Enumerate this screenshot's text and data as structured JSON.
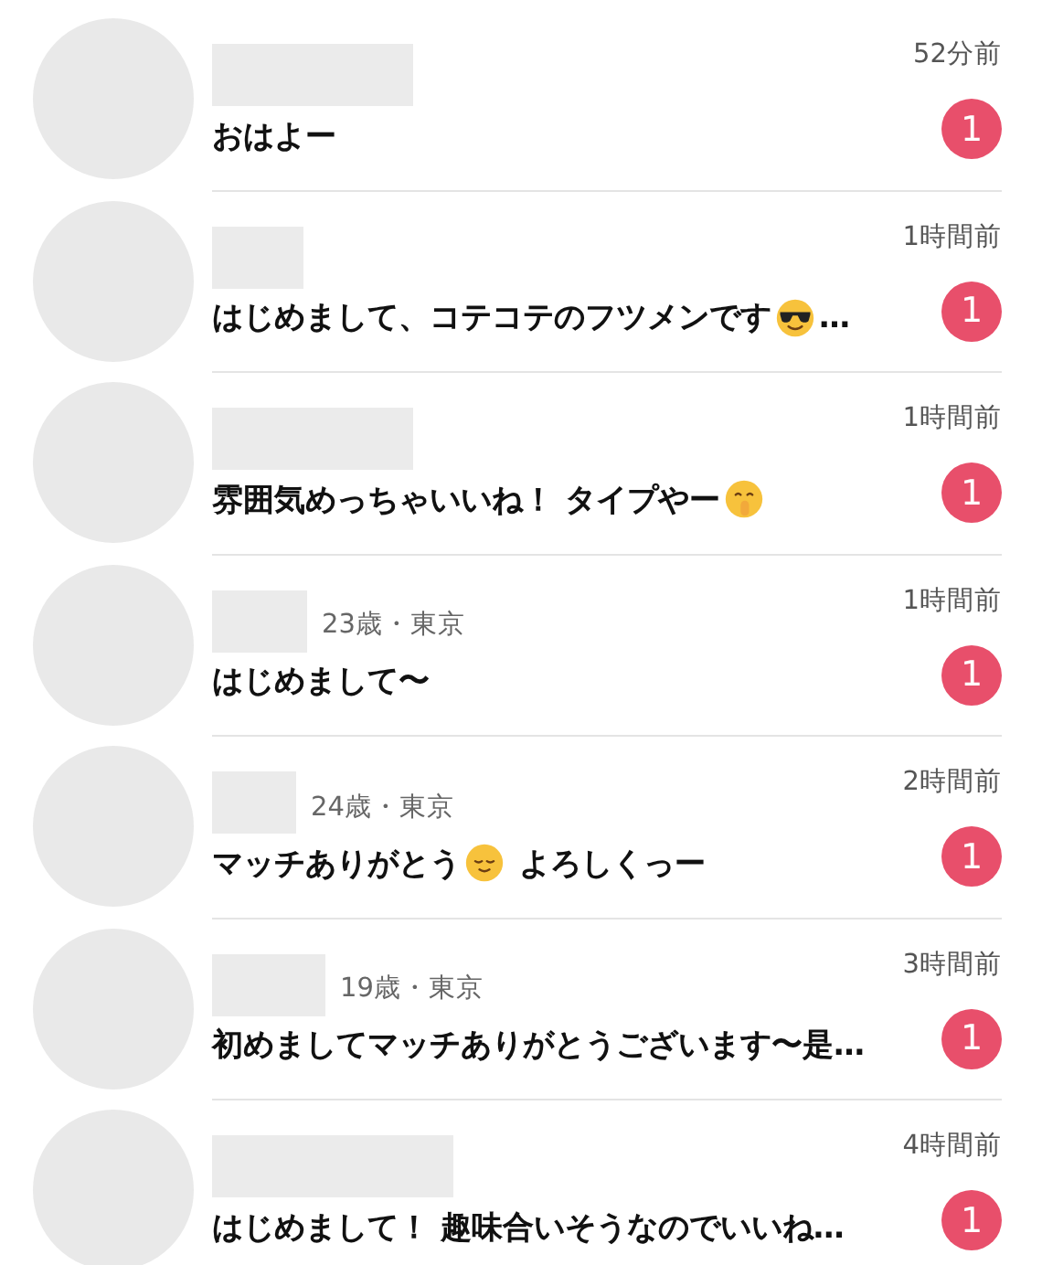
{
  "chats": [
    {
      "time": "52分前",
      "message": [
        {
          "kind": "text",
          "text": "おはよー"
        }
      ],
      "unread": "1"
    },
    {
      "time": "1時間前",
      "message": [
        {
          "kind": "text",
          "text": "はじめまして、コテコテのフツメンです"
        },
        {
          "kind": "cool-emoji"
        },
        {
          "kind": "text",
          "text": "…"
        }
      ],
      "unread": "1"
    },
    {
      "time": "1時間前",
      "message": [
        {
          "kind": "text",
          "text": "雰囲気めっちゃいいね！ タイプやー"
        },
        {
          "kind": "shush-emoji"
        }
      ],
      "unread": "1"
    },
    {
      "profile": "23歳・東京",
      "time": "1時間前",
      "message": [
        {
          "kind": "text",
          "text": "はじめまして〜"
        }
      ],
      "unread": "1"
    },
    {
      "profile": "24歳・東京",
      "time": "2時間前",
      "message": [
        {
          "kind": "text",
          "text": "マッチありがとう"
        },
        {
          "kind": "calm-emoji"
        },
        {
          "kind": "text",
          "text": " よろしくっー"
        }
      ],
      "unread": "1"
    },
    {
      "profile": "19歳・東京",
      "time": "3時間前",
      "message": [
        {
          "kind": "text",
          "text": "初めましてマッチありがとうございます〜是…"
        }
      ],
      "unread": "1"
    },
    {
      "time": "4時間前",
      "message": [
        {
          "kind": "text",
          "text": "はじめまして！ 趣味合いそうなのでいいね…"
        }
      ],
      "unread": "1"
    }
  ]
}
